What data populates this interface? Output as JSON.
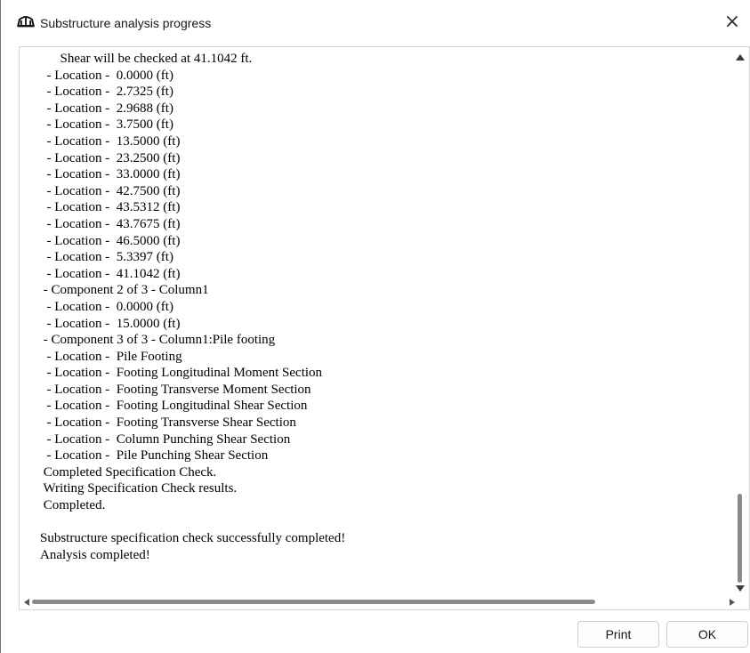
{
  "window": {
    "title": "Substructure analysis progress",
    "close_label": "×",
    "icon": "bridge-icon"
  },
  "log": {
    "lines": [
      "      Shear will be checked at 41.1042 ft.",
      "  - Location -  0.0000 (ft)",
      "  - Location -  2.7325 (ft)",
      "  - Location -  2.9688 (ft)",
      "  - Location -  3.7500 (ft)",
      "  - Location -  13.5000 (ft)",
      "  - Location -  23.2500 (ft)",
      "  - Location -  33.0000 (ft)",
      "  - Location -  42.7500 (ft)",
      "  - Location -  43.5312 (ft)",
      "  - Location -  43.7675 (ft)",
      "  - Location -  46.5000 (ft)",
      "  - Location -  5.3397 (ft)",
      "  - Location -  41.1042 (ft)",
      " - Component 2 of 3 - Column1",
      "  - Location -  0.0000 (ft)",
      "  - Location -  15.0000 (ft)",
      " - Component 3 of 3 - Column1:Pile footing",
      "  - Location -  Pile Footing",
      "  - Location -  Footing Longitudinal Moment Section",
      "  - Location -  Footing Transverse Moment Section",
      "  - Location -  Footing Longitudinal Shear Section",
      "  - Location -  Footing Transverse Shear Section",
      "  - Location -  Column Punching Shear Section",
      "  - Location -  Pile Punching Shear Section",
      " Completed Specification Check.",
      " Writing Specification Check results.",
      " Completed.",
      "",
      "Substructure specification check successfully completed!",
      "Analysis completed!"
    ]
  },
  "buttons": {
    "print_label": "Print",
    "ok_label": "OK"
  }
}
